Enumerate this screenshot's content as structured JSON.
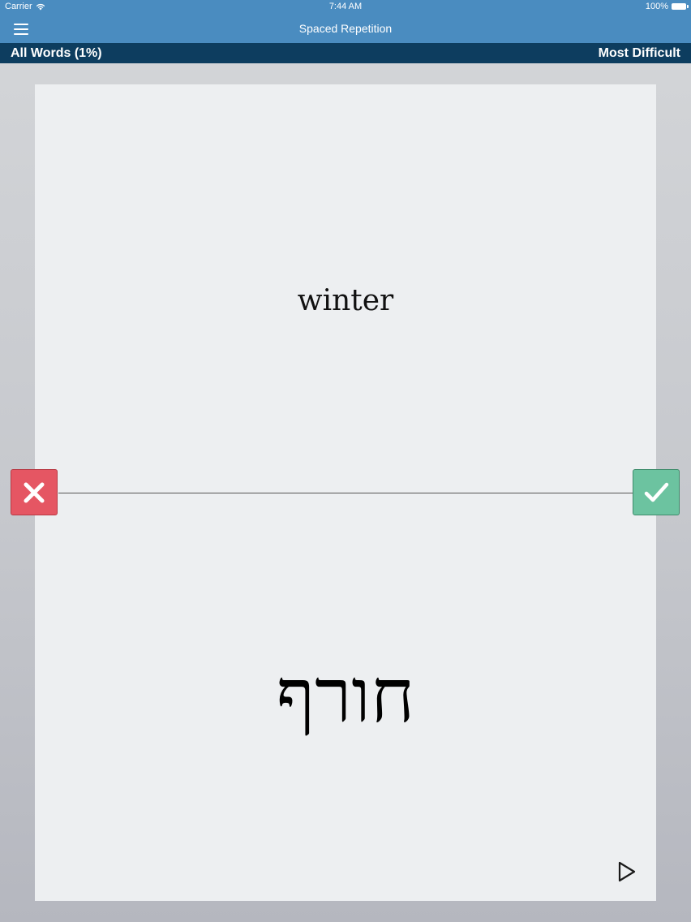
{
  "status_bar": {
    "carrier": "Carrier",
    "time": "7:44 AM",
    "battery": "100%",
    "wifi_icon": "wifi-icon",
    "battery_icon": "battery-icon"
  },
  "nav": {
    "title": "Spaced Repetition",
    "menu_icon": "hamburger-menu-icon"
  },
  "sub_bar": {
    "left_label": "All Words (1%)",
    "right_label": "Most Difficult"
  },
  "card": {
    "english_word": "winter",
    "hebrew_word": "חורף",
    "play_icon": "play-icon"
  },
  "actions": {
    "wrong_icon": "x-icon",
    "right_icon": "checkmark-icon"
  },
  "colors": {
    "header_blue": "#4a8cc0",
    "sub_bar_navy": "#0d3d5f",
    "wrong_red": "#e55663",
    "right_green": "#6cc3a0",
    "card_background": "#edeff1"
  }
}
